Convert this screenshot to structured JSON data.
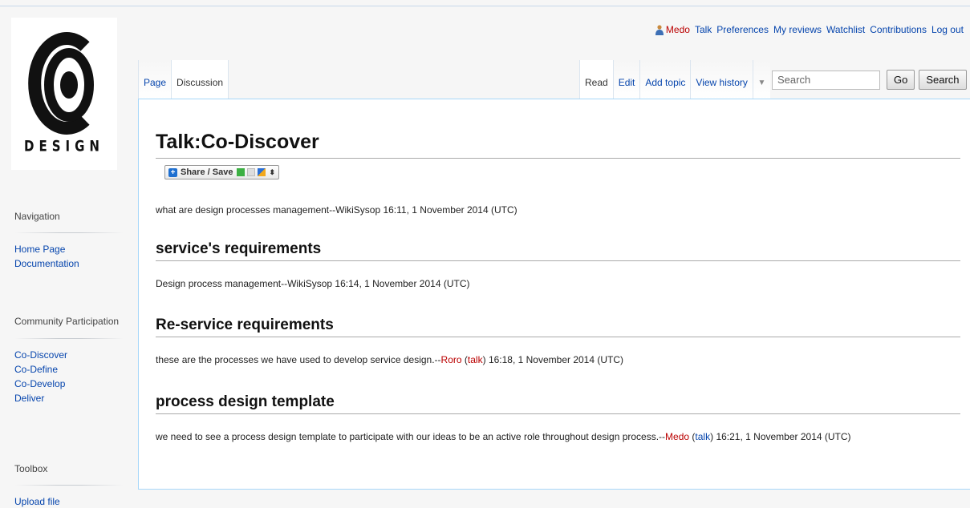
{
  "personal": {
    "user": "Medo",
    "links": [
      "Talk",
      "Preferences",
      "My reviews",
      "Watchlist",
      "Contributions",
      "Log out"
    ]
  },
  "logo": {
    "text": "DESIGN"
  },
  "tabs": {
    "namespaces": [
      "Page",
      "Discussion"
    ],
    "views": [
      "Read",
      "Edit",
      "Add topic",
      "View history"
    ]
  },
  "search": {
    "placeholder": "Search",
    "go_label": "Go",
    "search_label": "Search"
  },
  "sidebar": {
    "navigation": {
      "heading": "Navigation",
      "items": [
        "Home Page",
        "Documentation"
      ]
    },
    "community": {
      "heading": "Community Participation",
      "items": [
        "Co-Discover",
        "Co-Define",
        "Co-Develop",
        "Deliver"
      ]
    },
    "toolbox": {
      "heading": "Toolbox",
      "items": [
        "Upload file"
      ]
    }
  },
  "content": {
    "title": "Talk:Co-Discover",
    "share_label": "Share / Save",
    "intro": "what are design processes management--WikiSysop 16:11, 1 November 2014 (UTC)",
    "sections": [
      {
        "heading": "service's requirements",
        "text": "Design process management--WikiSysop 16:14, 1 November 2014 (UTC)"
      },
      {
        "heading": "Re-service requirements",
        "text_before": "these are the processes we have used to develop service design.--",
        "user": "Roro",
        "talk": "talk",
        "signature_time": "16:18, 1 November 2014 (UTC)"
      },
      {
        "heading": "process design template",
        "text_before": "we need to see a process design template to participate with our ideas to be an active role throughout design process.--",
        "user": "Medo",
        "talk": "talk",
        "signature_time": "16:21, 1 November 2014 (UTC)"
      }
    ]
  },
  "colors": {
    "link": "#0645ad",
    "redlink": "#ba0000",
    "content_border": "#a7d7f9"
  }
}
